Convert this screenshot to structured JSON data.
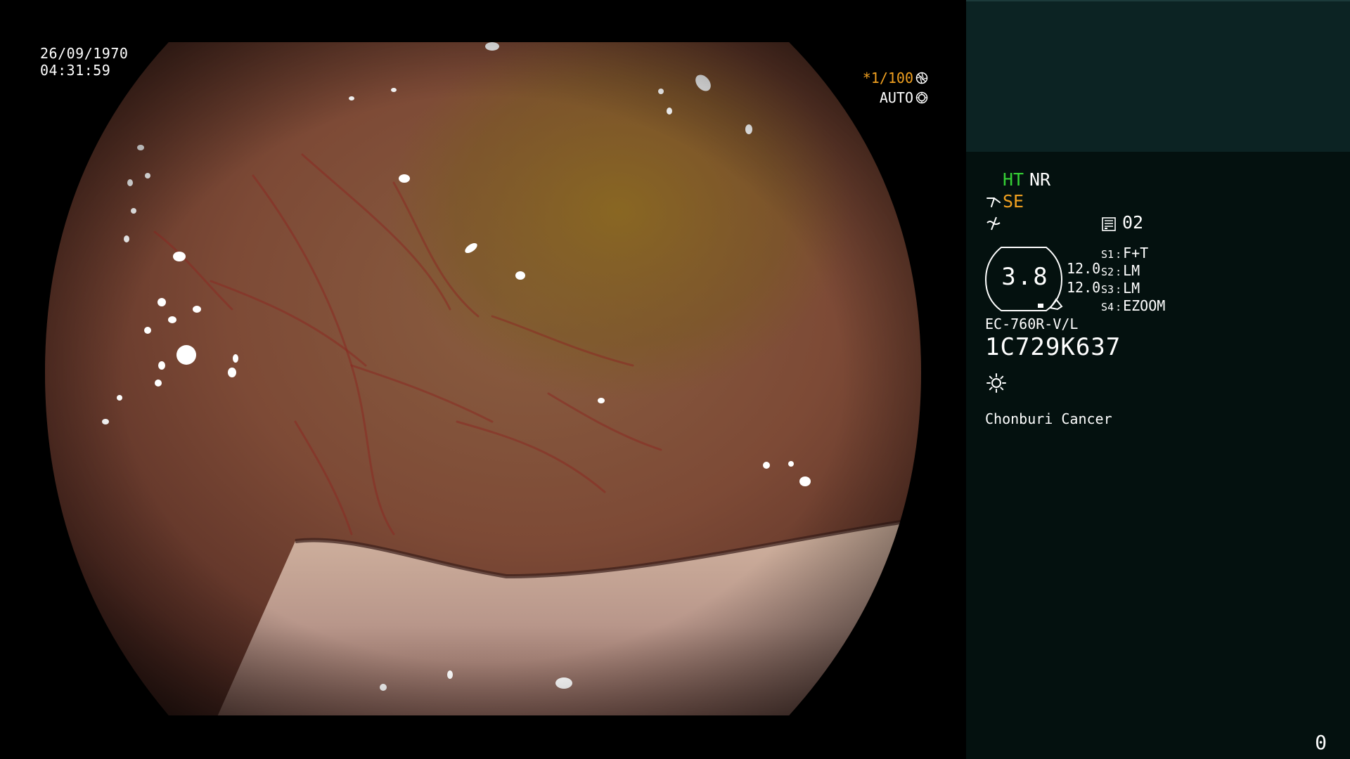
{
  "overlay": {
    "date": "26/09/1970",
    "time": "04:31:59",
    "shutter_speed": "*1/100",
    "iris_mode": "AUTO"
  },
  "panel": {
    "mode_ht": "HT",
    "mode_nr": "NR",
    "mode_se": "SE",
    "memo_count": "02",
    "zoom_value": "3.8",
    "enhance_1": "12.0",
    "enhance_2": "12.0",
    "switches": [
      {
        "key": "S1",
        "value": "F+T"
      },
      {
        "key": "S2",
        "value": "LM"
      },
      {
        "key": "S3",
        "value": "LM"
      },
      {
        "key": "S4",
        "value": "EZOOM"
      }
    ],
    "scope_model": "EC-760R-V/L",
    "scope_serial": "1C729K637",
    "institution": "Chonburi Cancer",
    "counter": "0"
  },
  "icons": {
    "shutter": "aperture-icon",
    "iris": "iris-icon",
    "structure_enhance": "scope-angle-icon",
    "wave": "wave-slash-icon",
    "memo": "memo-icon",
    "light": "light-sun-icon"
  },
  "colors": {
    "green_mode": "#35d035",
    "orange_mode": "#f0a020",
    "panel_bg": "#04110f",
    "panel_header_bg": "#0c2323"
  }
}
